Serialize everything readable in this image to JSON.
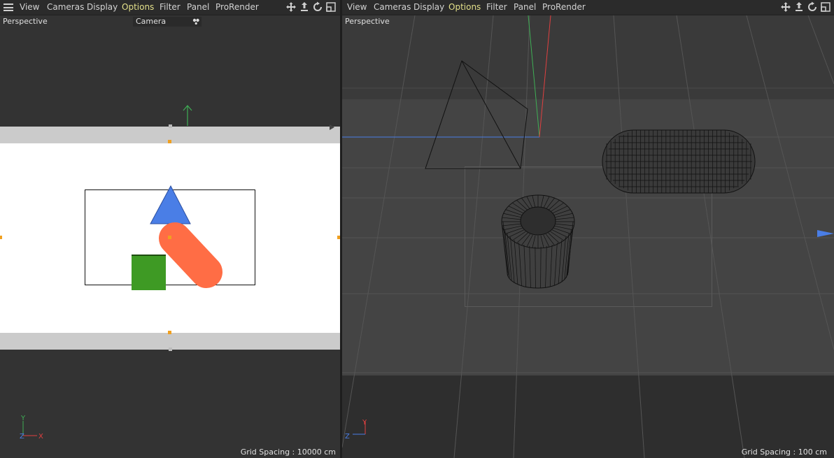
{
  "menu": {
    "items": [
      "View",
      "Cameras",
      "Display",
      "Options",
      "Filter",
      "Panel",
      "ProRender"
    ],
    "active": "Options"
  },
  "left_viewport": {
    "label": "Perspective",
    "camera_field": "Camera",
    "grid_spacing": "Grid Spacing : 10000 cm",
    "axis": {
      "y": "Y",
      "x": "X",
      "z": "Z"
    }
  },
  "right_viewport": {
    "label": "Perspective",
    "grid_spacing": "Grid Spacing : 100 cm",
    "axis": {
      "y": "Y",
      "z": "Z"
    }
  },
  "icons": [
    "menu-icon",
    "move-view-icon",
    "zoom-view-icon",
    "rotate-view-icon",
    "maximize-view-icon",
    "camera-link-icon"
  ],
  "colors": {
    "active_menu": "#e3e08a",
    "triangle": "#4a7ee6",
    "capsule": "#ff6d45",
    "cube": "#3e9a24",
    "axis_x": "#e04040",
    "axis_y": "#3fae55",
    "axis_z": "#4a7ee6"
  }
}
